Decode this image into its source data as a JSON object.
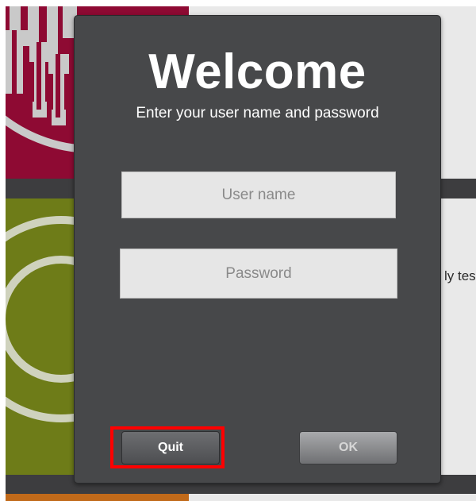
{
  "dialog": {
    "title": "Welcome",
    "subtitle": "Enter your user name and password",
    "username_placeholder": "User name",
    "username_value": "",
    "password_placeholder": "Password",
    "password_value": "",
    "quit_label": "Quit",
    "ok_label": "OK"
  },
  "background": {
    "partial_text": "ly tes"
  },
  "colors": {
    "dialog_bg": "#47484a",
    "tile_red": "#8e0a33",
    "tile_green": "#6e7c18",
    "tile_orange": "#c16a1a",
    "highlight": "#ff0000"
  }
}
